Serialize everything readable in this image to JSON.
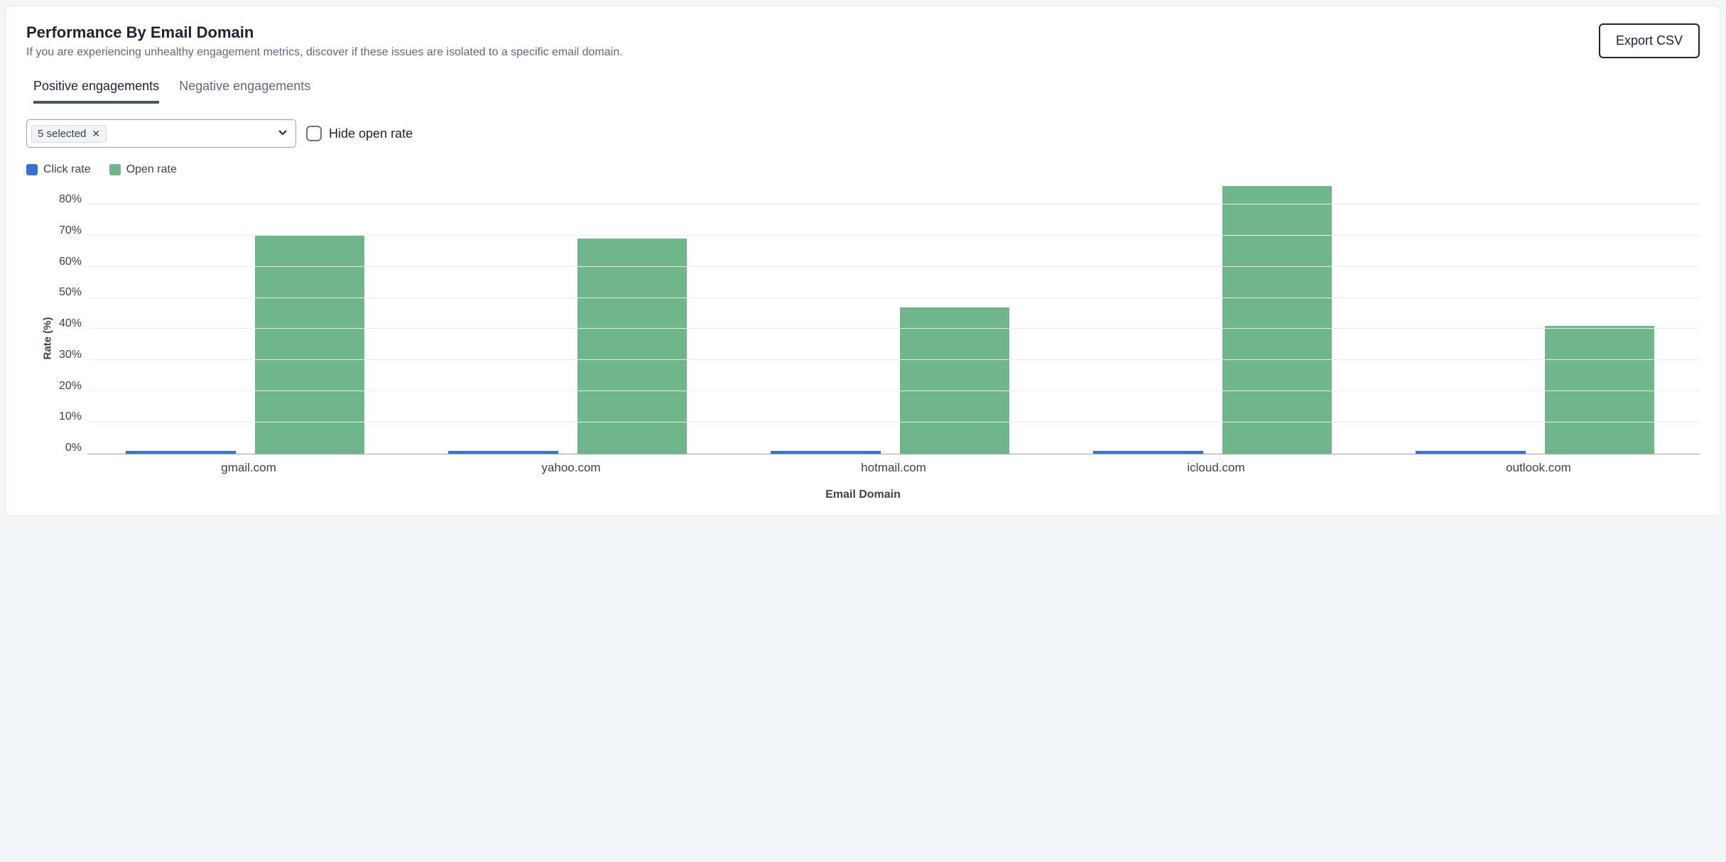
{
  "header": {
    "title": "Performance By Email Domain",
    "subtitle": "If you are experiencing unhealthy engagement metrics, discover if these issues are isolated to a specific email domain.",
    "export_label": "Export CSV"
  },
  "tabs": [
    {
      "label": "Positive engagements",
      "active": true
    },
    {
      "label": "Negative engagements",
      "active": false
    }
  ],
  "controls": {
    "select_chip": "5 selected",
    "checkbox_label": "Hide open rate",
    "checkbox_checked": false
  },
  "legend": {
    "click": "Click rate",
    "open": "Open rate"
  },
  "chart_data": {
    "type": "bar",
    "xlabel": "Email Domain",
    "ylabel": "Rate (%)",
    "ylim": [
      0,
      85
    ],
    "yticks": [
      "80%",
      "70%",
      "60%",
      "50%",
      "40%",
      "30%",
      "20%",
      "10%",
      "0%"
    ],
    "ytick_values": [
      80,
      70,
      60,
      50,
      40,
      30,
      20,
      10,
      0
    ],
    "categories": [
      "gmail.com",
      "yahoo.com",
      "hotmail.com",
      "icloud.com",
      "outlook.com"
    ],
    "series": [
      {
        "name": "Click rate",
        "color": "#3a6fd8",
        "values": [
          1,
          1,
          1,
          1,
          1
        ]
      },
      {
        "name": "Open rate",
        "color": "#6fb68b",
        "values": [
          70,
          69,
          47,
          86,
          41
        ]
      }
    ]
  }
}
